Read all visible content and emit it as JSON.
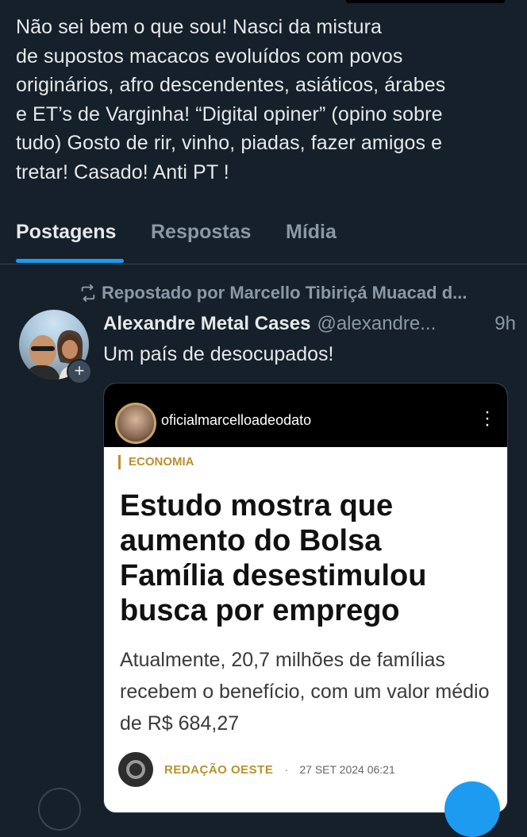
{
  "profile": {
    "bio": "Não sei bem o que sou! Nasci da mistura\nde supostos macacos evoluídos com povos\noriginários, afro descendentes, asiáticos, árabes\ne ET’s de Varginha! “Digital opiner” (opino sobre\ntudo) Gosto de rir, vinho, piadas, fazer amigos e\ntretar! Casado! Anti PT !"
  },
  "tabs": [
    {
      "label": "Postagens",
      "active": true
    },
    {
      "label": "Respostas",
      "active": false
    },
    {
      "label": "Mídia",
      "active": false
    }
  ],
  "tweet": {
    "repost_text": "Repostado por Marcello Tibiriçá Muacad d...",
    "author": "Alexandre Metal Cases",
    "handle": "@alexandre...",
    "time": "9h",
    "text": "Um país de desocupados!",
    "media": {
      "insta_user": "oficialmarcelloadeodato",
      "section": "ECONOMIA",
      "headline": "Estudo mostra que aumento do Bolsa Família desestimulou busca por emprego",
      "subtitle": "Atualmente, 20,7 milhões de famílias recebem o benefício, com um valor médio de R$ 684,27",
      "source": "REDAÇÃO OESTE",
      "separator": "·",
      "date": "27 SET 2024 06:21"
    }
  },
  "colors": {
    "background": "#15202b",
    "accent": "#1d9bf0",
    "muted": "#8b98a5",
    "section_gold": "#b8912f"
  },
  "icons": {
    "repost": "repost-icon",
    "menu": "vertical-dots-icon",
    "plus": "plus-icon"
  }
}
